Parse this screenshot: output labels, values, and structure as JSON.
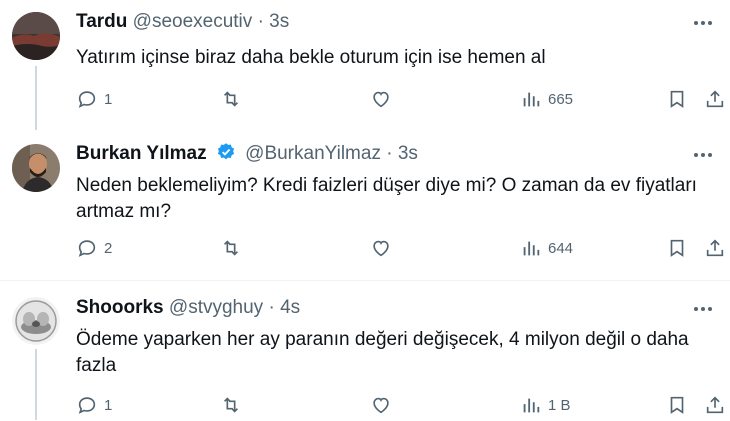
{
  "tweets": [
    {
      "name": "Tardu",
      "handle": "@seoexecutiv",
      "separator": "·",
      "time": "3s",
      "verified": false,
      "text": "Yatırım içinse biraz daha bekle oturum için ise hemen al",
      "replies": "1",
      "retweets": "",
      "likes": "",
      "views": "665"
    },
    {
      "name": "Burkan Yılmaz",
      "handle": "@BurkanYilmaz",
      "separator": "·",
      "time": "3s",
      "verified": true,
      "text": "Neden beklemeliyim? Kredi faizleri düşer diye mi? O zaman da ev fiyatları artmaz mı?",
      "replies": "2",
      "retweets": "",
      "likes": "",
      "views": "644"
    },
    {
      "name": "Shooorks",
      "handle": "@stvyghuy",
      "separator": "·",
      "time": "4s",
      "verified": false,
      "text": "Ödeme yaparken her ay paranın değeri değişecek, 4 milyon değil o daha fazla",
      "replies": "1",
      "retweets": "",
      "likes": "",
      "views": "1 B"
    }
  ],
  "colors": {
    "verified_blue": "#1d9bf0",
    "muted": "#536471",
    "thread_line": "#cfd9de"
  }
}
